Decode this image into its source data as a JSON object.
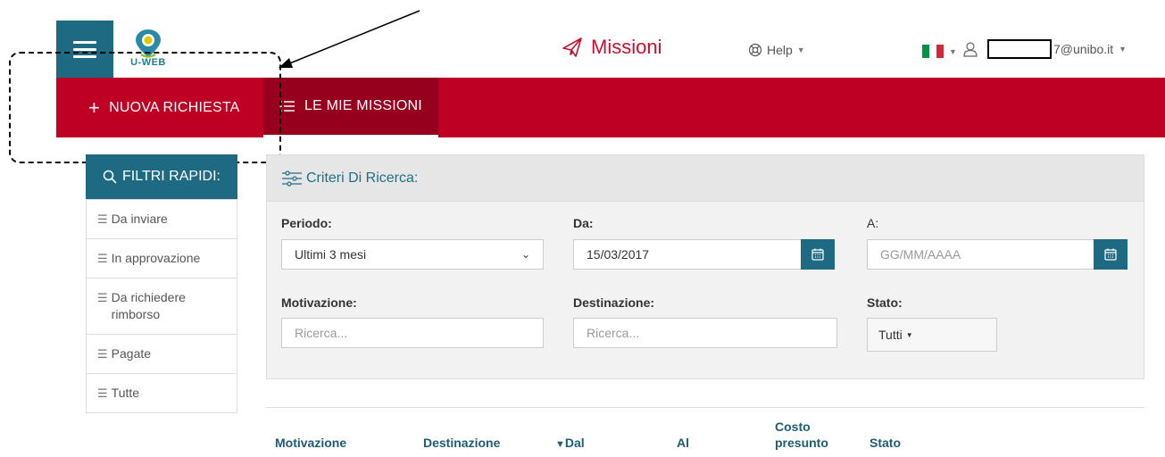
{
  "header": {
    "logo_text": "U-WEB",
    "app_title": "Missioni",
    "help_label": "Help",
    "user_email_suffix": "7@unibo.it"
  },
  "nav": {
    "new_request": "NUOVA RICHIESTA",
    "my_missions": "LE MIE MISSIONI"
  },
  "sidebar": {
    "title": "FILTRI RAPIDI:",
    "items": [
      {
        "label": "Da inviare"
      },
      {
        "label": "In approvazione"
      },
      {
        "label": "Da richiedere rimborso"
      },
      {
        "label": "Pagate"
      },
      {
        "label": "Tutte"
      }
    ]
  },
  "search": {
    "title": "Criteri Di Ricerca:",
    "period_label": "Periodo:",
    "period_value": "Ultimi 3 mesi",
    "from_label": "Da:",
    "from_value": "15/03/2017",
    "to_label": "A:",
    "to_placeholder": "GG/MM/AAAA",
    "motivation_label": "Motivazione:",
    "motivation_placeholder": "Ricerca...",
    "destination_label": "Destinazione:",
    "destination_placeholder": "Ricerca...",
    "status_label": "Stato:",
    "status_value": "Tutti"
  },
  "table": {
    "columns": [
      "Motivazione",
      "Destinazione",
      "Dal",
      "Al",
      "Costo presunto",
      "Stato"
    ]
  },
  "colors": {
    "brand_red": "#bf0025",
    "brand_teal": "#1d6a82"
  },
  "icons": [
    "menu-icon",
    "location-pin-icon",
    "airplane-icon",
    "lifebuoy-icon",
    "user-icon",
    "plus-icon",
    "list-icon",
    "search-icon",
    "sliders-icon",
    "calendar-icon",
    "caret-down-icon",
    "sort-desc-icon"
  ]
}
